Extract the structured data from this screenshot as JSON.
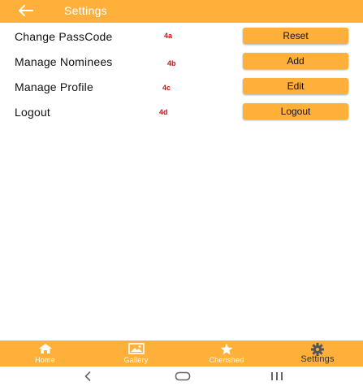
{
  "header": {
    "title": "Settings",
    "back_icon": "arrow-left-icon"
  },
  "colors": {
    "accent": "#FFB03B",
    "note": "#CC1111"
  },
  "settings_rows": [
    {
      "label": "Change PassCode",
      "note": "4a",
      "button": "Reset"
    },
    {
      "label": "Manage Nominees",
      "note": "4b",
      "button": "Add"
    },
    {
      "label": "Manage Profile",
      "note": "4c",
      "button": "Edit"
    },
    {
      "label": "Logout",
      "note": "4d",
      "button": "Logout"
    }
  ],
  "bottom_nav": {
    "items": [
      {
        "label": "Home",
        "icon": "home-icon"
      },
      {
        "label": "Gallery",
        "icon": "gallery-icon"
      },
      {
        "label": "Cherished",
        "icon": "star-icon"
      },
      {
        "label": "Settings",
        "icon": "gear-icon"
      }
    ],
    "active": "Settings"
  },
  "system_nav": {
    "icons": [
      "back-chevron-icon",
      "home-circle-icon",
      "recents-icon"
    ]
  }
}
